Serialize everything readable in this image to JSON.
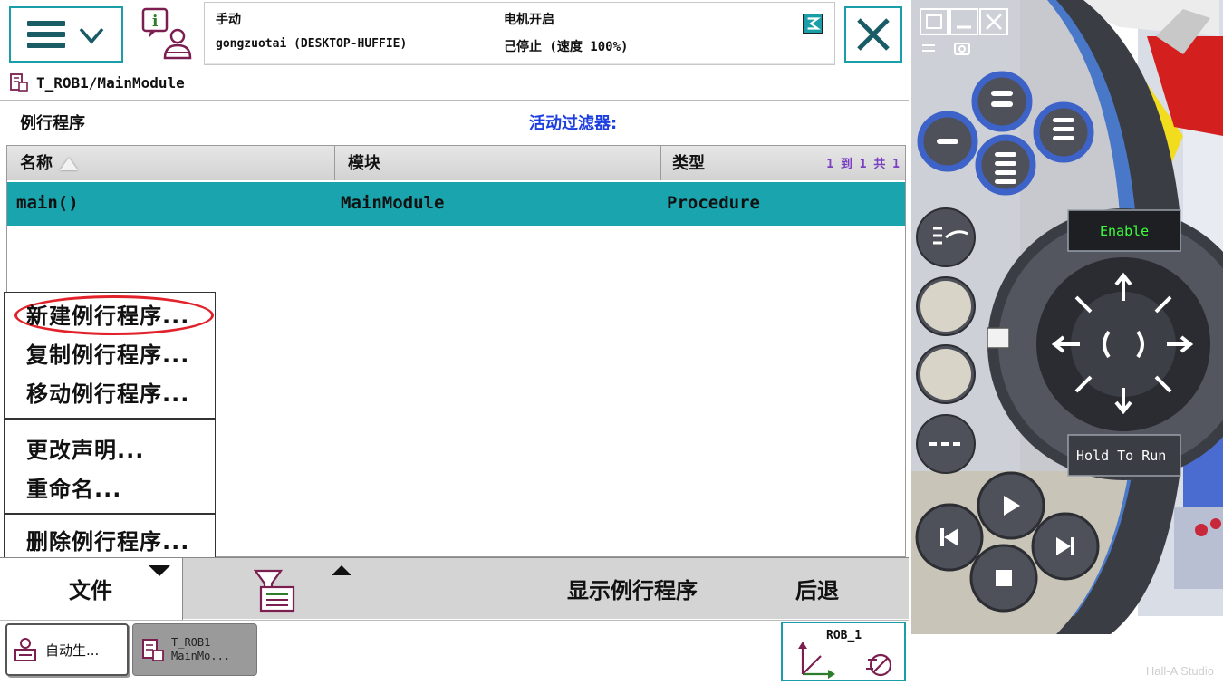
{
  "header": {
    "mode": "手动",
    "station": "gongzuotai (DESKTOP-HUFFIE)",
    "motor": "电机开启",
    "state": "己停止 (速度 100%)"
  },
  "breadcrumb": "T_ROB1/MainModule",
  "section_title": "例行程序",
  "filter_label": "活动过滤器:",
  "table": {
    "columns": [
      "名称",
      "模块",
      "类型"
    ],
    "range_text": "1 到 1 共 1",
    "rows": [
      {
        "name": "main()",
        "module": "MainModule",
        "type": "Procedure"
      }
    ]
  },
  "file_menu": {
    "items": [
      "新建例行程序...",
      "复制例行程序...",
      "移动例行程序...",
      "更改声明...",
      "重命名...",
      "删除例行程序..."
    ]
  },
  "bottom_bar": {
    "file": "文件",
    "show_routine": "显示例行程序",
    "back": "后退"
  },
  "taskbar": {
    "task1": "自动生...",
    "task2_line1": "T_ROB1",
    "task2_line2": "MainMo...",
    "robot": "ROB_1"
  },
  "pendant": {
    "enable": "Enable",
    "hold_to_run": "Hold To Run",
    "watermark": "Hall-A Studio"
  },
  "colors": {
    "accent": "#1aa4ad",
    "filter_blue": "#1e3fe0",
    "highlight_red": "#e2222a",
    "range_purple": "#7b3fc2"
  }
}
